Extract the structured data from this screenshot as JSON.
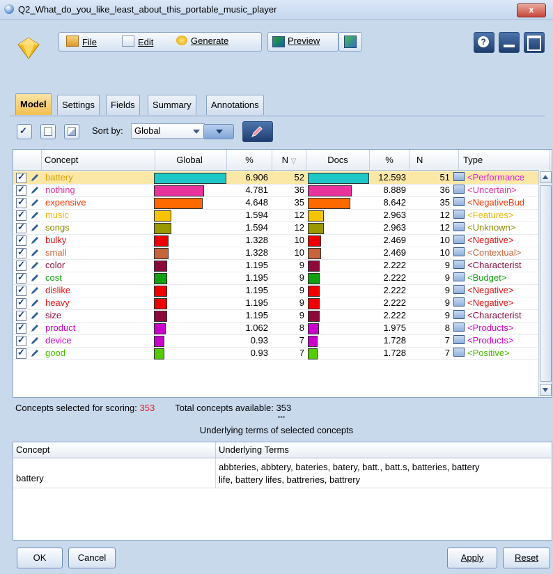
{
  "window": {
    "title": "Q2_What_do_you_like_least_about_this_portable_music_player",
    "close_label": "x"
  },
  "menu": {
    "file": "File",
    "edit": "Edit",
    "generate": "Generate",
    "preview": "Preview",
    "file_key": "F",
    "edit_key": "E",
    "generate_key": "G",
    "preview_key": "P"
  },
  "tabs": [
    "Model",
    "Settings",
    "Fields",
    "Summary",
    "Annotations"
  ],
  "toolbar": {
    "sort_label": "Sort by:",
    "sort_value": "Global"
  },
  "table": {
    "headers": {
      "concept": "Concept",
      "global": "Global",
      "pct": "%",
      "n": "N",
      "docs": "Docs",
      "pct2": "%",
      "n2": "N",
      "type": "Type"
    },
    "rows": [
      {
        "concept": "battery",
        "global_frac": 1.0,
        "pct": "6.906",
        "n": "52",
        "docs_frac": 1.0,
        "pct2": "12.593",
        "n2": "51",
        "type": "<Performance",
        "color": "#20c7c7",
        "ccolor": "#d4a000",
        "tcolor": "#e020e0"
      },
      {
        "concept": "nothing",
        "global_frac": 0.69,
        "pct": "4.781",
        "n": "36",
        "docs_frac": 0.71,
        "pct2": "8.889",
        "n2": "36",
        "type": "<Uncertain>",
        "color": "#e8339c",
        "ccolor": "#e8339c",
        "tcolor": "#e8339c"
      },
      {
        "concept": "expensive",
        "global_frac": 0.67,
        "pct": "4.648",
        "n": "35",
        "docs_frac": 0.69,
        "pct2": "8.642",
        "n2": "35",
        "type": "<NegativeBud",
        "color": "#ff6a00",
        "ccolor": "#ff3300",
        "tcolor": "#ff3300"
      },
      {
        "concept": "music",
        "global_frac": 0.23,
        "pct": "1.594",
        "n": "12",
        "docs_frac": 0.24,
        "pct2": "2.963",
        "n2": "12",
        "type": "<Features>",
        "color": "#f5c400",
        "ccolor": "#e6b800",
        "tcolor": "#e6b800"
      },
      {
        "concept": "songs",
        "global_frac": 0.23,
        "pct": "1.594",
        "n": "12",
        "docs_frac": 0.24,
        "pct2": "2.963",
        "n2": "12",
        "type": "<Unknown>",
        "color": "#9a9a00",
        "ccolor": "#8a8a00",
        "tcolor": "#8a8a00"
      },
      {
        "concept": "bulky",
        "global_frac": 0.19,
        "pct": "1.328",
        "n": "10",
        "docs_frac": 0.2,
        "pct2": "2.469",
        "n2": "10",
        "type": "<Negative>",
        "color": "#ee0000",
        "ccolor": "#e01010",
        "tcolor": "#e01010"
      },
      {
        "concept": "small",
        "global_frac": 0.19,
        "pct": "1.328",
        "n": "10",
        "docs_frac": 0.2,
        "pct2": "2.469",
        "n2": "10",
        "type": "<Contextual>",
        "color": "#c8643c",
        "ccolor": "#c8643c",
        "tcolor": "#c8643c"
      },
      {
        "concept": "color",
        "global_frac": 0.17,
        "pct": "1.195",
        "n": "9",
        "docs_frac": 0.18,
        "pct2": "2.222",
        "n2": "9",
        "type": "<Characterist",
        "color": "#8b0a3a",
        "ccolor": "#8b0a3a",
        "tcolor": "#8b0a3a"
      },
      {
        "concept": "cost",
        "global_frac": 0.17,
        "pct": "1.195",
        "n": "9",
        "docs_frac": 0.18,
        "pct2": "2.222",
        "n2": "9",
        "type": "<Budget>",
        "color": "#10a010",
        "ccolor": "#10a010",
        "tcolor": "#10a010"
      },
      {
        "concept": "dislike",
        "global_frac": 0.17,
        "pct": "1.195",
        "n": "9",
        "docs_frac": 0.18,
        "pct2": "2.222",
        "n2": "9",
        "type": "<Negative>",
        "color": "#ee0000",
        "ccolor": "#e01010",
        "tcolor": "#e01010"
      },
      {
        "concept": "heavy",
        "global_frac": 0.17,
        "pct": "1.195",
        "n": "9",
        "docs_frac": 0.18,
        "pct2": "2.222",
        "n2": "9",
        "type": "<Negative>",
        "color": "#ee0000",
        "ccolor": "#e01010",
        "tcolor": "#e01010"
      },
      {
        "concept": "size",
        "global_frac": 0.17,
        "pct": "1.195",
        "n": "9",
        "docs_frac": 0.18,
        "pct2": "2.222",
        "n2": "9",
        "type": "<Characterist",
        "color": "#8b0a3a",
        "ccolor": "#8b0a3a",
        "tcolor": "#8b0a3a"
      },
      {
        "concept": "product",
        "global_frac": 0.15,
        "pct": "1.062",
        "n": "8",
        "docs_frac": 0.16,
        "pct2": "1.975",
        "n2": "8",
        "type": "<Products>",
        "color": "#cc00cc",
        "ccolor": "#cc00cc",
        "tcolor": "#cc00cc"
      },
      {
        "concept": "device",
        "global_frac": 0.13,
        "pct": "0.93",
        "n": "7",
        "docs_frac": 0.14,
        "pct2": "1.728",
        "n2": "7",
        "type": "<Products>",
        "color": "#cc00cc",
        "ccolor": "#cc00cc",
        "tcolor": "#cc00cc"
      },
      {
        "concept": "good",
        "global_frac": 0.13,
        "pct": "0.93",
        "n": "7",
        "docs_frac": 0.14,
        "pct2": "1.728",
        "n2": "7",
        "type": "<Positive>",
        "color": "#55cc00",
        "ccolor": "#44bb00",
        "tcolor": "#44bb00"
      }
    ]
  },
  "status": {
    "selected_label": "Concepts selected for scoring:",
    "selected_value": "353",
    "total_label": "Total concepts available:",
    "total_value": "353"
  },
  "splitter": "•••",
  "terms": {
    "title": "Underlying terms of selected concepts",
    "header_concept": "Concept",
    "header_terms": "Underlying Terms",
    "concept": "battery",
    "terms_line1": "abbteries, abbtery, bateries, batery, batt., batt.s, batteries, battery",
    "terms_line2": "life, battery lifes, battreries, battrery"
  },
  "buttons": {
    "ok": "OK",
    "cancel": "Cancel",
    "apply": "Apply",
    "reset": "Reset"
  }
}
